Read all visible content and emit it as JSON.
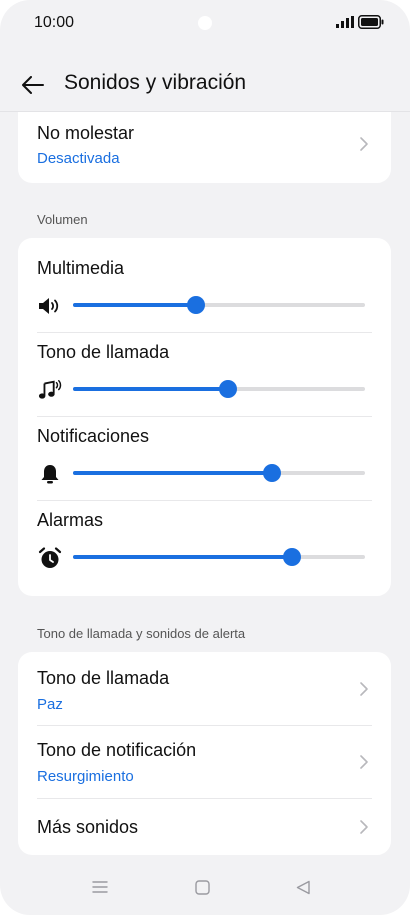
{
  "status_bar": {
    "time": "10:00",
    "icons": [
      "signal-icon",
      "battery-icon"
    ]
  },
  "header": {
    "title": "Sonidos y vibración",
    "back_icon": "back-arrow-icon"
  },
  "do_not_disturb": {
    "title": "No molestar",
    "value": "Desactivada"
  },
  "volume": {
    "section_label": "Volumen",
    "sliders": [
      {
        "label": "Multimedia",
        "icon": "speaker-icon",
        "level": 0.42
      },
      {
        "label": "Tono de llamada",
        "icon": "ringtone-icon",
        "level": 0.53
      },
      {
        "label": "Notificaciones",
        "icon": "bell-icon",
        "level": 0.68
      },
      {
        "label": "Alarmas",
        "icon": "alarm-clock-icon",
        "level": 0.75
      }
    ]
  },
  "alerts": {
    "section_label": "Tono de llamada y sonidos de alerta",
    "items": [
      {
        "title": "Tono de llamada",
        "value": "Paz"
      },
      {
        "title": "Tono de notificación",
        "value": "Resurgimiento"
      },
      {
        "title": "Más sonidos"
      }
    ]
  },
  "nav_bar": {
    "icons": [
      "menu-icon",
      "home-icon",
      "back-icon"
    ]
  },
  "colors": {
    "accent": "#1a6fe0",
    "background": "#f2f2f4",
    "card": "#ffffff",
    "track": "#dcdcde"
  }
}
